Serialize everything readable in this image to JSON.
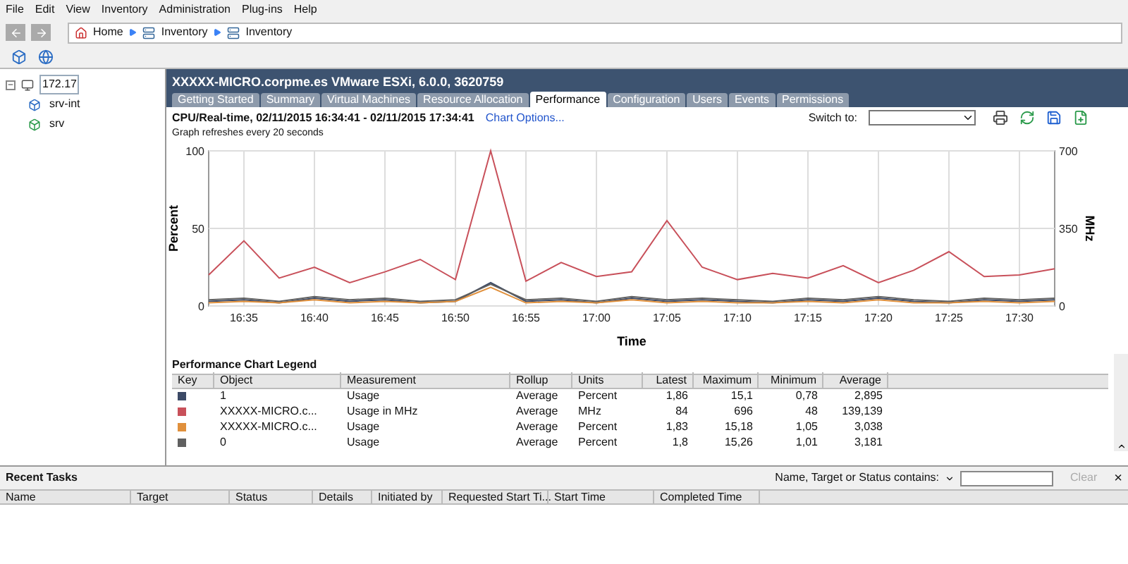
{
  "menu": [
    "File",
    "Edit",
    "View",
    "Inventory",
    "Administration",
    "Plug-ins",
    "Help"
  ],
  "breadcrumb": [
    "Home",
    "Inventory",
    "Inventory"
  ],
  "tree": [
    {
      "label": "172.17",
      "expanded": true,
      "selected": true,
      "children": [
        {
          "label": "srv-int",
          "selected": false
        },
        {
          "label": "srv",
          "selected": false
        }
      ]
    }
  ],
  "host_title": "XXXXX-MICRO.corpme.es VMware ESXi, 6.0.0, 3620759",
  "tabs": [
    {
      "label": "Getting Started",
      "selected": false
    },
    {
      "label": "Summary",
      "selected": false
    },
    {
      "label": "Virtual Machines",
      "selected": false
    },
    {
      "label": "Resource Allocation",
      "selected": false
    },
    {
      "label": "Performance",
      "selected": true
    },
    {
      "label": "Configuration",
      "selected": false
    },
    {
      "label": "Users",
      "selected": false
    },
    {
      "label": "Events",
      "selected": false
    },
    {
      "label": "Permissions",
      "selected": false
    }
  ],
  "performance": {
    "heading": "CPU/Real-time, 02/11/2015 16:34:41 - 02/11/2015 17:34:41",
    "chart_options": "Chart Options...",
    "refresh_note": "Graph refreshes every 20 seconds",
    "switch_label": "Switch to:",
    "chart_data": {
      "type": "line",
      "grid": true,
      "xlabel": "Time",
      "ylabel": "Percent",
      "categories": [
        null,
        "16:35",
        null,
        "16:40",
        null,
        "16:45",
        null,
        "16:50",
        null,
        "16:55",
        null,
        "17:00",
        null,
        "17:05",
        null,
        "17:10",
        null,
        "17:15",
        null,
        "17:20",
        null,
        "17:25",
        null,
        "17:30",
        null
      ],
      "ylim": [
        0,
        100
      ],
      "yticks": [
        0,
        50,
        100
      ],
      "series": [
        {
          "name": "1",
          "color": "#3c4a66",
          "values": [
            3,
            4,
            2,
            5,
            3,
            4,
            2,
            3,
            15,
            3,
            4,
            2,
            5,
            3,
            4,
            3,
            2,
            4,
            3,
            5,
            3,
            2,
            4,
            3,
            4
          ]
        },
        {
          "name": "XXXXX-MICRO.c...",
          "color": "#c8505a",
          "values": [
            20,
            42,
            18,
            25,
            15,
            22,
            30,
            17,
            100,
            16,
            28,
            19,
            22,
            55,
            25,
            17,
            21,
            18,
            26,
            15,
            23,
            35,
            19,
            20,
            24
          ]
        },
        {
          "name": "XXXXX-MICRO.c...",
          "color": "#e0903c",
          "values": [
            2,
            3,
            2,
            4,
            2,
            3,
            2,
            3,
            12,
            2,
            3,
            2,
            4,
            2,
            3,
            2,
            2,
            3,
            2,
            4,
            2,
            2,
            3,
            2,
            3
          ]
        },
        {
          "name": "0",
          "color": "#606060",
          "values": [
            4,
            5,
            3,
            6,
            4,
            5,
            3,
            4,
            14,
            4,
            5,
            3,
            6,
            4,
            5,
            4,
            3,
            5,
            4,
            6,
            4,
            3,
            5,
            4,
            5
          ]
        }
      ]
    },
    "right_axis": {
      "label": "MHz",
      "ticks": [
        "700",
        "350",
        "0"
      ]
    },
    "legend_title": "Performance Chart Legend",
    "legend_columns": [
      "Key",
      "Object",
      "Measurement",
      "Rollup",
      "Units",
      "Latest",
      "Maximum",
      "Minimum",
      "Average"
    ],
    "legend_rows": [
      {
        "cells": [
          "Usage",
          "Average",
          "Percent",
          "1,86",
          "15,1",
          "0,78",
          "2,895"
        ]
      },
      {
        "cells": [
          "Usage in MHz",
          "Average",
          "MHz",
          "84",
          "696",
          "48",
          "139,139"
        ]
      },
      {
        "cells": [
          "Usage",
          "Average",
          "Percent",
          "1,83",
          "15,18",
          "1,05",
          "3,038"
        ]
      },
      {
        "cells": [
          "Usage",
          "Average",
          "Percent",
          "1,8",
          "15,26",
          "1,01",
          "3,181"
        ]
      }
    ]
  },
  "recent_tasks": {
    "title": "Recent Tasks",
    "filter_label": "Name, Target or Status contains:",
    "clear": "Clear",
    "close": "×",
    "columns": [
      "Name",
      "Target",
      "Status",
      "Details",
      "Initiated by",
      "Requested Start Ti...",
      "Start Time",
      "Completed Time"
    ]
  }
}
